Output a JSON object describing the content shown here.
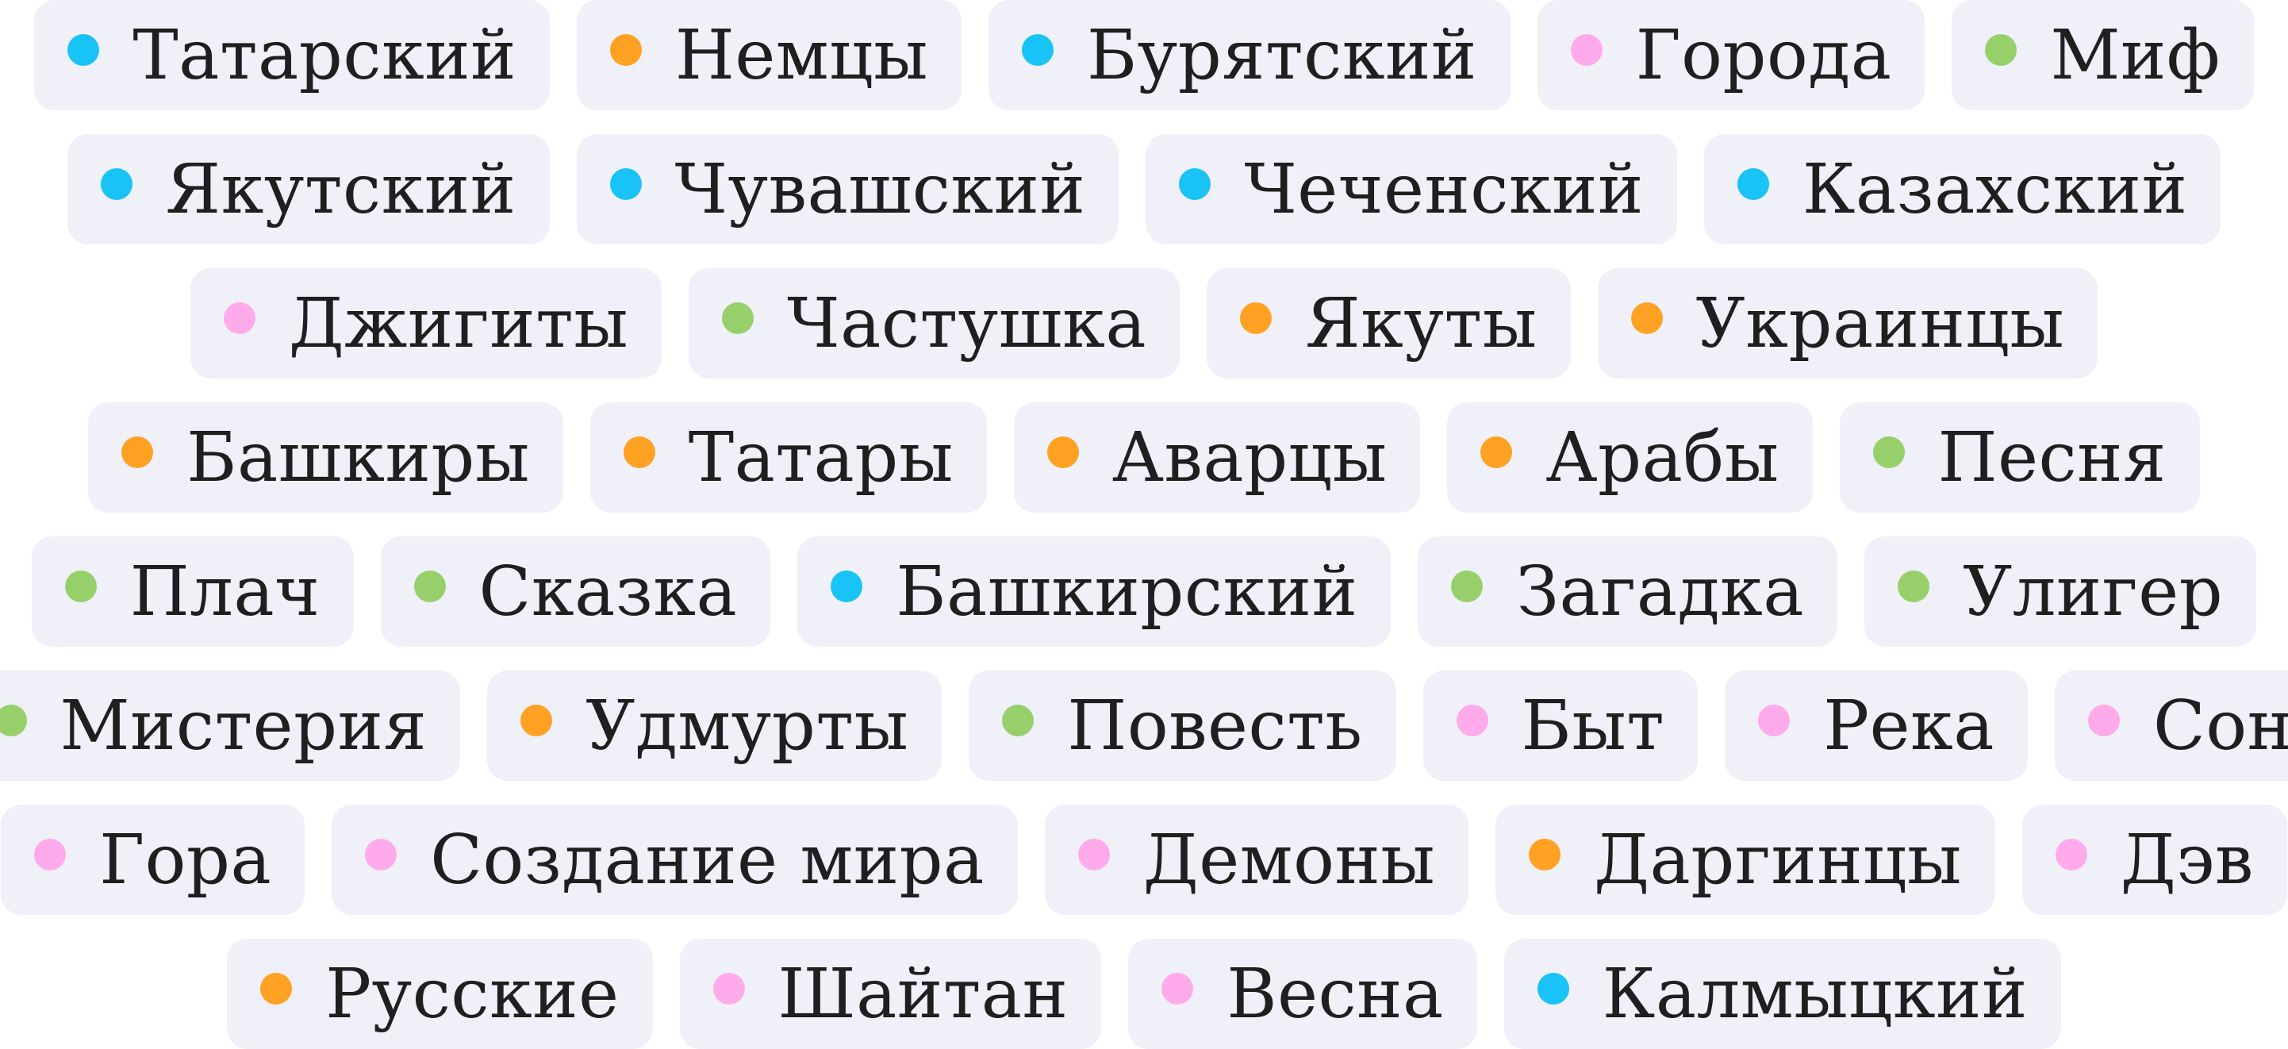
{
  "category_colors": {
    "language": "#19c3f5",
    "people": "#ffa123",
    "genre": "#97d06a",
    "theme": "#ffaaea"
  },
  "rows": [
    [
      {
        "label": "Татарский",
        "category": "language"
      },
      {
        "label": "Немцы",
        "category": "people"
      },
      {
        "label": "Бурятский",
        "category": "language"
      },
      {
        "label": "Города",
        "category": "theme"
      },
      {
        "label": "Миф",
        "category": "genre"
      }
    ],
    [
      {
        "label": "Якутский",
        "category": "language"
      },
      {
        "label": "Чувашский",
        "category": "language"
      },
      {
        "label": "Чеченский",
        "category": "language"
      },
      {
        "label": "Казахский",
        "category": "language"
      }
    ],
    [
      {
        "label": "Джигиты",
        "category": "theme"
      },
      {
        "label": "Частушка",
        "category": "genre"
      },
      {
        "label": "Якуты",
        "category": "people"
      },
      {
        "label": "Украинцы",
        "category": "people"
      }
    ],
    [
      {
        "label": "Башкиры",
        "category": "people"
      },
      {
        "label": "Татары",
        "category": "people"
      },
      {
        "label": "Аварцы",
        "category": "people"
      },
      {
        "label": "Арабы",
        "category": "people"
      },
      {
        "label": "Песня",
        "category": "genre"
      }
    ],
    [
      {
        "label": "Плач",
        "category": "genre"
      },
      {
        "label": "Сказка",
        "category": "genre"
      },
      {
        "label": "Башкирский",
        "category": "language"
      },
      {
        "label": "Загадка",
        "category": "genre"
      },
      {
        "label": "Улигер",
        "category": "genre"
      }
    ],
    [
      {
        "label": "Мистерия",
        "category": "genre"
      },
      {
        "label": "Удмурты",
        "category": "people"
      },
      {
        "label": "Повесть",
        "category": "genre"
      },
      {
        "label": "Быт",
        "category": "theme"
      },
      {
        "label": "Река",
        "category": "theme"
      },
      {
        "label": "Сон",
        "category": "theme"
      }
    ],
    [
      {
        "label": "Гора",
        "category": "theme"
      },
      {
        "label": "Создание мира",
        "category": "theme"
      },
      {
        "label": "Демоны",
        "category": "theme"
      },
      {
        "label": "Даргинцы",
        "category": "people"
      },
      {
        "label": "Дэв",
        "category": "theme"
      }
    ],
    [
      {
        "label": "Русские",
        "category": "people"
      },
      {
        "label": "Шайтан",
        "category": "theme"
      },
      {
        "label": "Весна",
        "category": "theme"
      },
      {
        "label": "Калмыцкий",
        "category": "language"
      }
    ]
  ]
}
